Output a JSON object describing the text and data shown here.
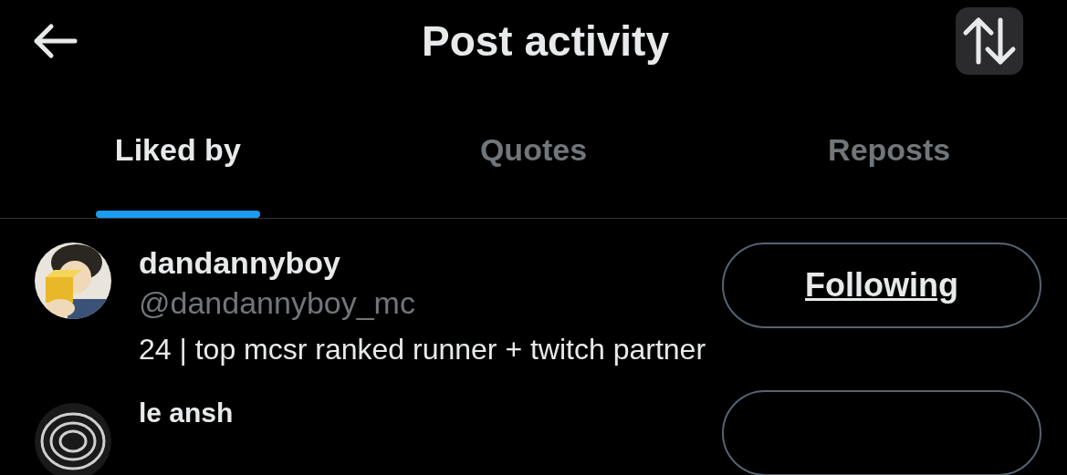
{
  "header": {
    "title": "Post activity"
  },
  "tabs": [
    {
      "label": "Liked by",
      "selected": true
    },
    {
      "label": "Quotes",
      "selected": false
    },
    {
      "label": "Reposts",
      "selected": false
    }
  ],
  "users": [
    {
      "name": "dandannyboy",
      "handle": "@dandannyboy_mc",
      "bio": "24 | top mcsr ranked runner + twitch partner",
      "button": "Following"
    },
    {
      "name": "le ansh"
    }
  ]
}
